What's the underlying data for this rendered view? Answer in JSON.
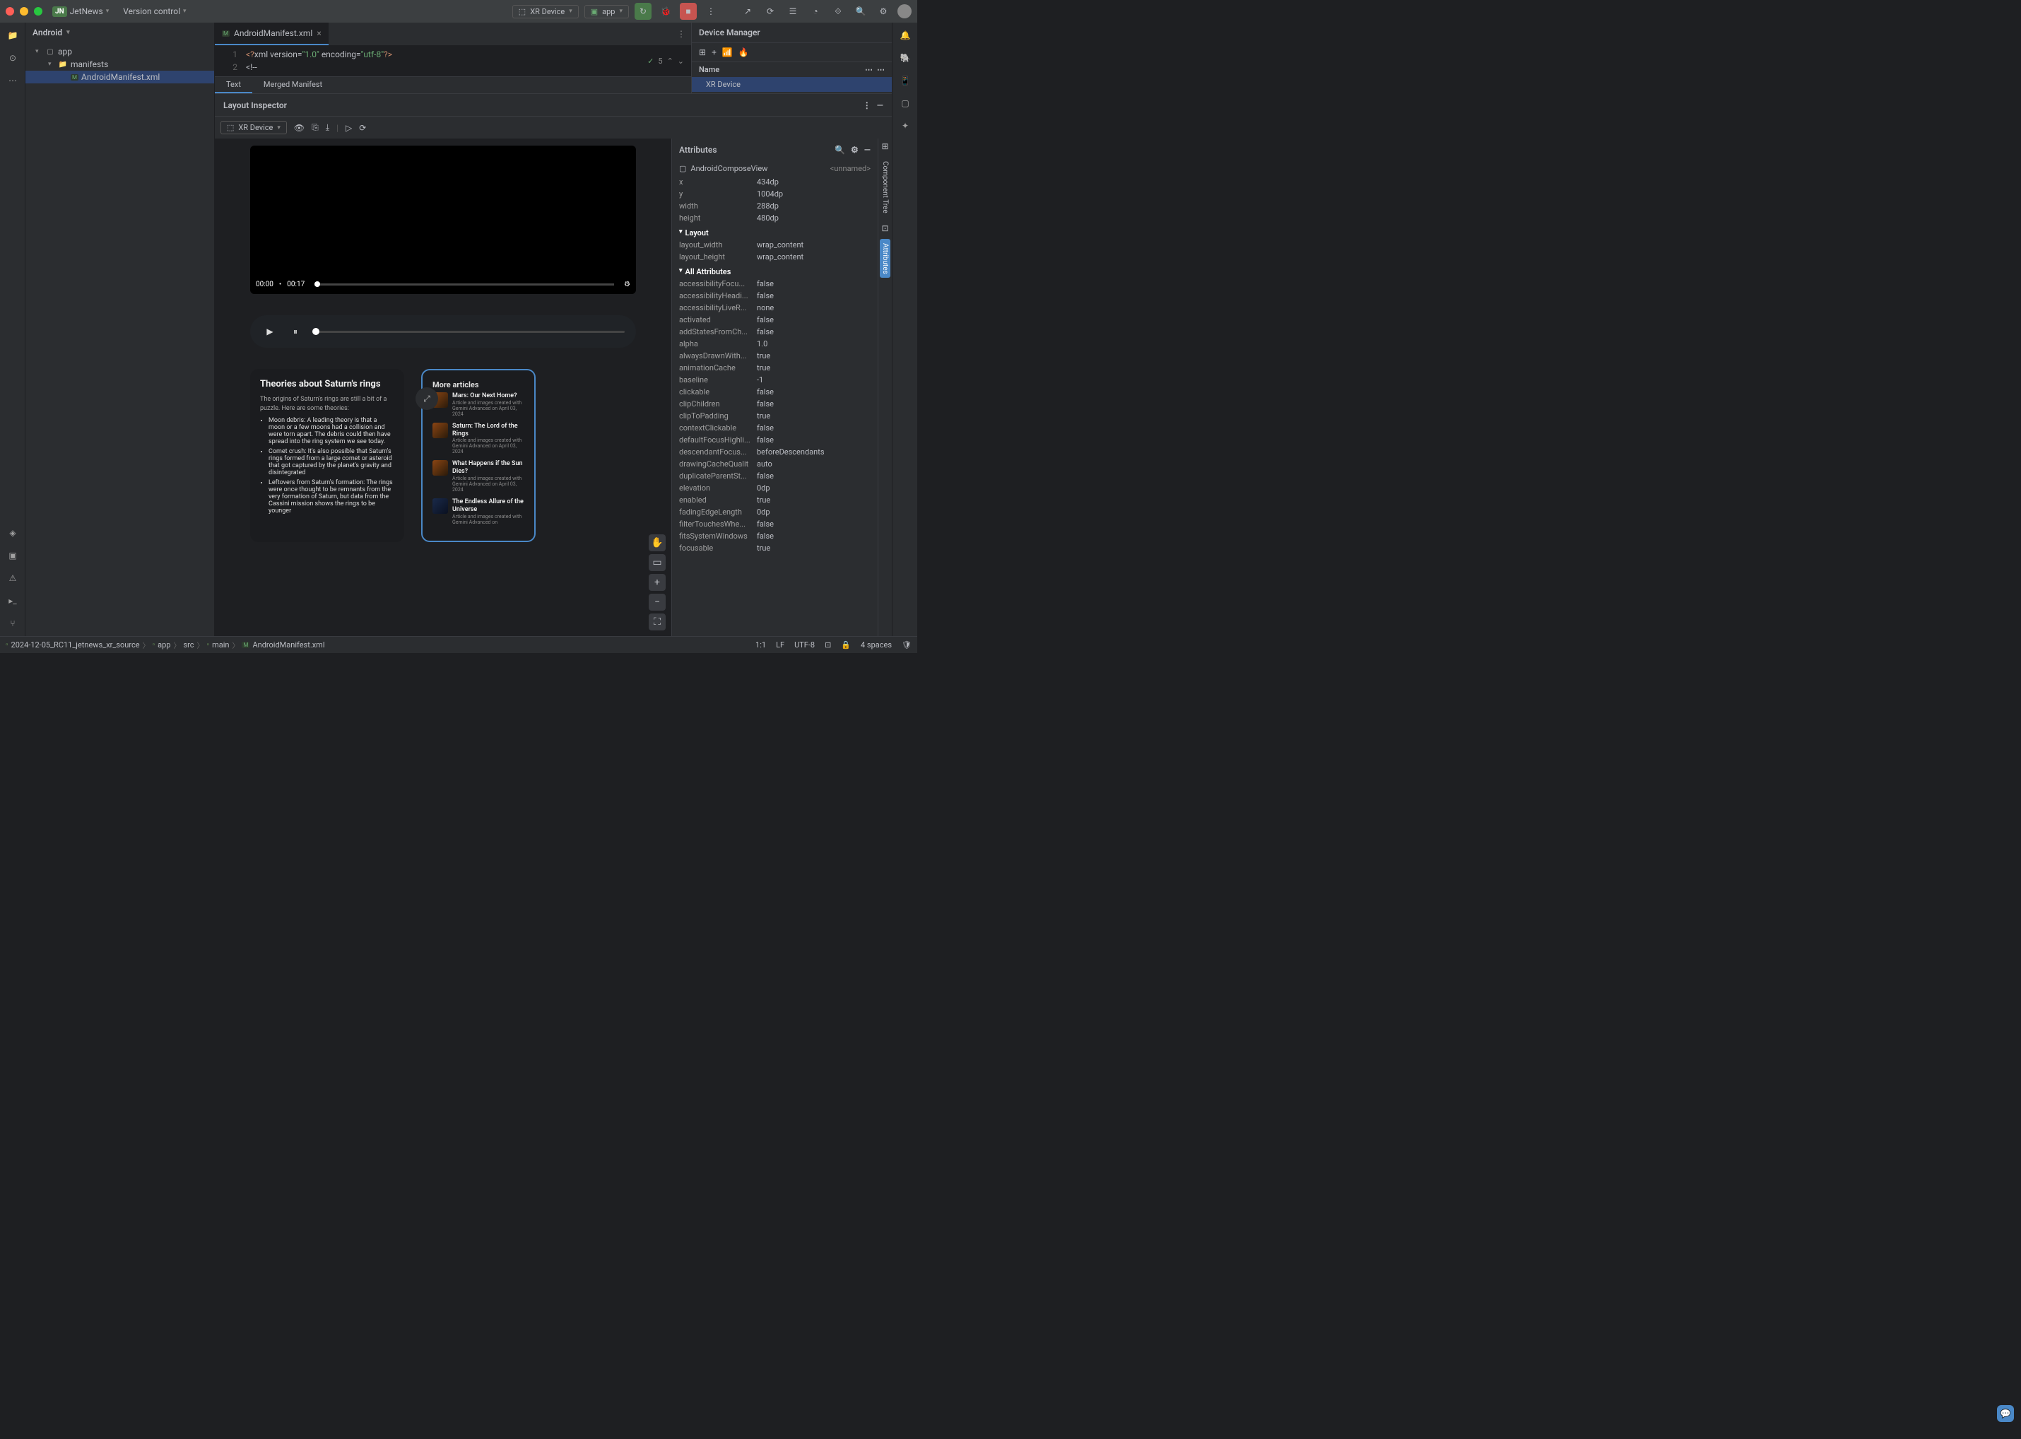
{
  "titlebar": {
    "project_name": "JetNews",
    "project_badge": "JN",
    "version_control": "Version control",
    "device": "XR Device",
    "run_config": "app"
  },
  "project_panel": {
    "title": "Android",
    "tree": {
      "app": "app",
      "manifests": "manifests",
      "manifest_file": "AndroidManifest.xml"
    }
  },
  "editor": {
    "tab_name": "AndroidManifest.xml",
    "lines": [
      {
        "num": "1",
        "code": "<?xml version=\"1.0\" encoding=\"utf-8\"?>"
      },
      {
        "num": "2",
        "code": "<!--"
      }
    ],
    "problems_count": "5",
    "sub_tabs": {
      "text": "Text",
      "merged": "Merged Manifest"
    }
  },
  "inspector": {
    "title": "Layout Inspector",
    "device_selector": "XR Device"
  },
  "device_manager": {
    "title": "Device Manager",
    "col_name": "Name",
    "device": "XR Device"
  },
  "preview": {
    "video": {
      "current_time": "00:00",
      "duration": "00:17"
    },
    "card1": {
      "title": "Theories about Saturn's rings",
      "intro": "The origins of Saturn's rings are still a bit of a puzzle. Here are some theories:",
      "bullets": [
        "Moon debris: A leading theory is that a moon or a few moons had a collision and were torn apart. The debris could then have spread into the ring system we see today.",
        "Comet crush: It's also possible that Saturn's rings formed from a large comet or asteroid that got captured by the planet's gravity and disintegrated",
        "Leftovers from Saturn's formation: The rings were once thought to be remnants from the very formation of Saturn, but data from the Cassini mission shows the rings to be younger"
      ]
    },
    "card2": {
      "title": "More articles",
      "articles": [
        {
          "title": "Mars: Our Next Home?",
          "meta": "Article and images created with Gemini Advanced on April 03, 2024"
        },
        {
          "title": "Saturn: The Lord of the Rings",
          "meta": "Article and images created with Gemini Advanced on April 03, 2024"
        },
        {
          "title": "What Happens if the Sun Dies?",
          "meta": "Article and images created with Gemini Advanced on April 03, 2024"
        },
        {
          "title": "The Endless Allure of the Universe",
          "meta": "Article and images created with Gemini Advanced on"
        }
      ]
    }
  },
  "attributes": {
    "title": "Attributes",
    "element_type": "AndroidComposeView",
    "element_name": "<unnamed>",
    "basic": [
      {
        "k": "x",
        "v": "434dp"
      },
      {
        "k": "y",
        "v": "1004dp"
      },
      {
        "k": "width",
        "v": "288dp"
      },
      {
        "k": "height",
        "v": "480dp"
      }
    ],
    "layout_group": "Layout",
    "layout": [
      {
        "k": "layout_width",
        "v": "wrap_content"
      },
      {
        "k": "layout_height",
        "v": "wrap_content"
      }
    ],
    "all_group": "All Attributes",
    "all": [
      {
        "k": "accessibilityFocu...",
        "v": "false"
      },
      {
        "k": "accessibilityHeadi...",
        "v": "false"
      },
      {
        "k": "accessibilityLiveR...",
        "v": "none"
      },
      {
        "k": "activated",
        "v": "false"
      },
      {
        "k": "addStatesFromCh...",
        "v": "false"
      },
      {
        "k": "alpha",
        "v": "1.0"
      },
      {
        "k": "alwaysDrawnWith...",
        "v": "true"
      },
      {
        "k": "animationCache",
        "v": "true"
      },
      {
        "k": "baseline",
        "v": "-1"
      },
      {
        "k": "clickable",
        "v": "false"
      },
      {
        "k": "clipChildren",
        "v": "false"
      },
      {
        "k": "clipToPadding",
        "v": "true"
      },
      {
        "k": "contextClickable",
        "v": "false"
      },
      {
        "k": "defaultFocusHighli...",
        "v": "false"
      },
      {
        "k": "descendantFocus...",
        "v": "beforeDescendants"
      },
      {
        "k": "drawingCacheQualit",
        "v": "auto"
      },
      {
        "k": "duplicateParentSt...",
        "v": "false"
      },
      {
        "k": "elevation",
        "v": "0dp"
      },
      {
        "k": "enabled",
        "v": "true"
      },
      {
        "k": "fadingEdgeLength",
        "v": "0dp"
      },
      {
        "k": "filterTouchesWhe...",
        "v": "false"
      },
      {
        "k": "fitsSystemWindows",
        "v": "false"
      },
      {
        "k": "focusable",
        "v": "true"
      }
    ]
  },
  "right_tabs": {
    "component_tree": "Component Tree",
    "attributes": "Attributes"
  },
  "statusbar": {
    "breadcrumbs": [
      "2024-12-05_RC11_jetnews_xr_source",
      "app",
      "src",
      "main",
      "AndroidManifest.xml"
    ],
    "position": "1:1",
    "line_ending": "LF",
    "encoding": "UTF-8",
    "indent": "4 spaces"
  }
}
